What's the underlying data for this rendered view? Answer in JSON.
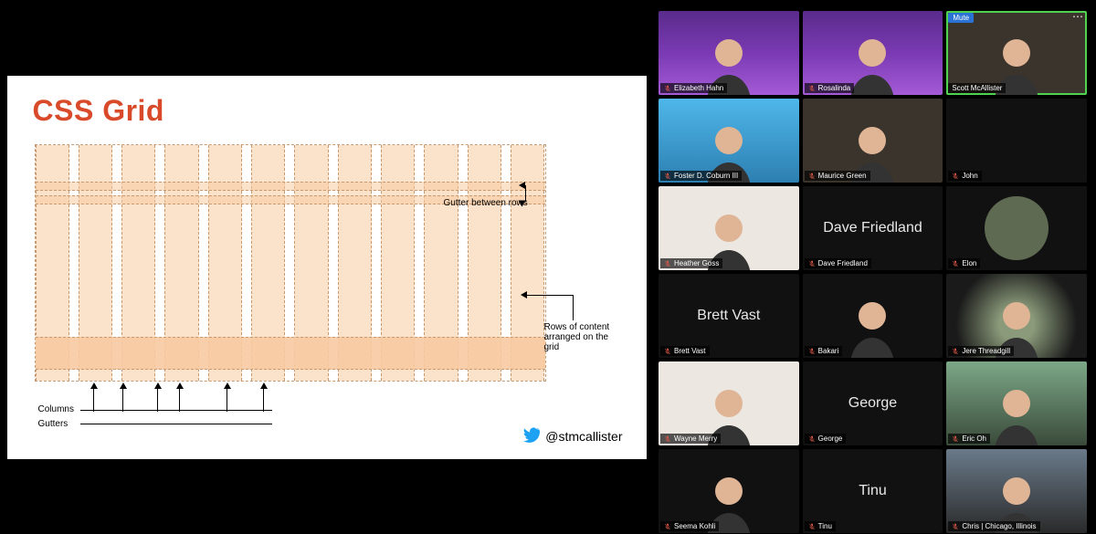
{
  "slide": {
    "title": "CSS Grid",
    "labels": {
      "gutter_rows": "Gutter between rows",
      "rows_content": "Rows of content\narranged on the\ngrid",
      "columns": "Columns",
      "gutters": "Gutters"
    },
    "twitter_handle": "@stmcallister"
  },
  "mute_label": "Mute",
  "participants": [
    {
      "name": "Elizabeth Hahn",
      "muted": true,
      "videoOn": true,
      "bg": "purple-bg",
      "speaking": false
    },
    {
      "name": "Rosalinda",
      "muted": true,
      "videoOn": true,
      "bg": "purple-bg",
      "speaking": false
    },
    {
      "name": "Scott McAllister",
      "muted": false,
      "videoOn": true,
      "bg": "room-bg",
      "speaking": true,
      "hasMute": true
    },
    {
      "name": "Foster D. Coburn III",
      "muted": true,
      "videoOn": true,
      "bg": "beach-bg",
      "speaking": false
    },
    {
      "name": "Maurice Green",
      "muted": true,
      "videoOn": true,
      "bg": "room-bg",
      "speaking": false
    },
    {
      "name": "John",
      "muted": true,
      "videoOn": false,
      "bg": "plain-bg",
      "speaking": false
    },
    {
      "name": "Heather Goss",
      "muted": true,
      "videoOn": true,
      "bg": "white-bg",
      "speaking": false
    },
    {
      "name": "Dave Friedland",
      "muted": true,
      "videoOn": false,
      "bg": "plain-bg",
      "speaking": false,
      "big": "Dave Friedland"
    },
    {
      "name": "Elon",
      "muted": true,
      "videoOn": false,
      "bg": "plain-bg",
      "speaking": false,
      "circle": true
    },
    {
      "name": "Brett Vast",
      "muted": true,
      "videoOn": false,
      "bg": "plain-bg",
      "speaking": false,
      "big": "Brett Vast"
    },
    {
      "name": "Bakari",
      "muted": true,
      "videoOn": true,
      "bg": "plain-bg",
      "speaking": false
    },
    {
      "name": "Jere Threadgill",
      "muted": true,
      "videoOn": true,
      "bg": "drive-bg",
      "speaking": false
    },
    {
      "name": "Wayne Merry",
      "muted": true,
      "videoOn": true,
      "bg": "white-bg",
      "speaking": false
    },
    {
      "name": "George",
      "muted": true,
      "videoOn": false,
      "bg": "plain-bg",
      "speaking": false,
      "big": "George"
    },
    {
      "name": "Eric Oh",
      "muted": true,
      "videoOn": true,
      "bg": "car-bg",
      "speaking": false
    },
    {
      "name": "Seema Kohli",
      "muted": true,
      "videoOn": true,
      "bg": "plain-bg",
      "speaking": false
    },
    {
      "name": "Tinu",
      "muted": true,
      "videoOn": false,
      "bg": "plain-bg",
      "speaking": false,
      "big": "Tinu"
    },
    {
      "name": "Chris | Chicago, Illinois",
      "muted": true,
      "videoOn": true,
      "bg": "city-bg",
      "speaking": false
    }
  ]
}
